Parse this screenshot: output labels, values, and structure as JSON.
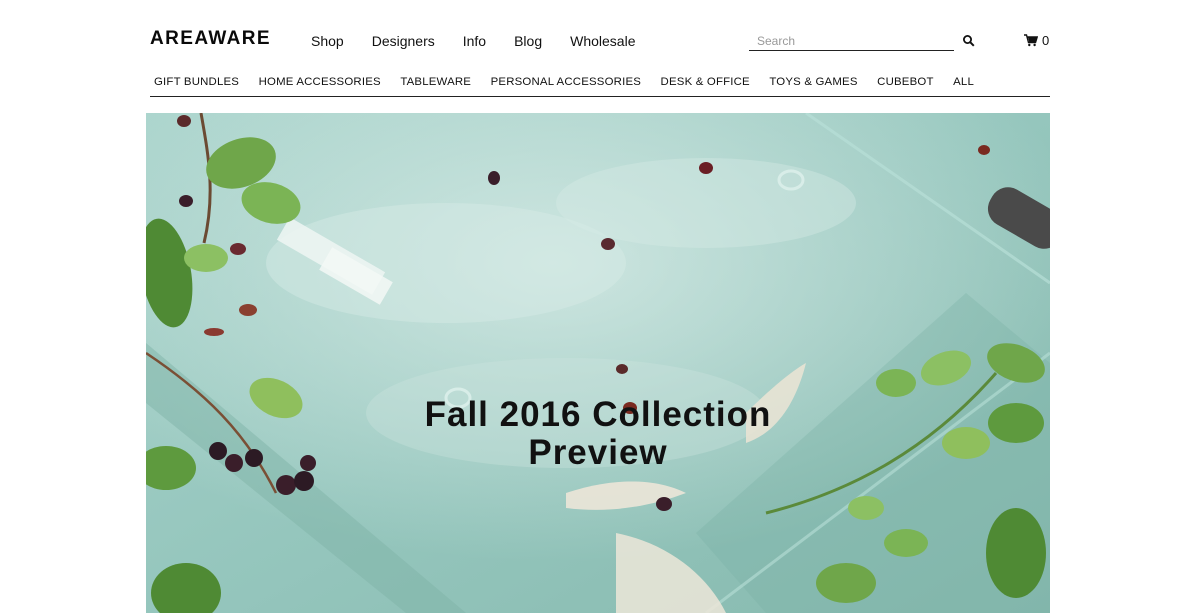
{
  "brand": {
    "name": "AREAWARE"
  },
  "main_nav": [
    {
      "label": "Shop"
    },
    {
      "label": "Designers"
    },
    {
      "label": "Info"
    },
    {
      "label": "Blog"
    },
    {
      "label": "Wholesale"
    }
  ],
  "search": {
    "placeholder": "Search",
    "icon": "search-icon"
  },
  "cart": {
    "count": "0",
    "icon": "cart-icon"
  },
  "categories": [
    {
      "label": "GIFT BUNDLES"
    },
    {
      "label": "HOME ACCESSORIES"
    },
    {
      "label": "TABLEWARE"
    },
    {
      "label": "PERSONAL ACCESSORIES"
    },
    {
      "label": "DESK & OFFICE"
    },
    {
      "label": "TOYS & GAMES"
    },
    {
      "label": "CUBEBOT"
    },
    {
      "label": "ALL"
    }
  ],
  "hero": {
    "title_line1": "Fall 2016 Collection",
    "title_line2": "Preview",
    "colors": {
      "water": "#9fcbc3",
      "leaf": "#6fa64a",
      "berry": "#3a1e2a"
    }
  }
}
